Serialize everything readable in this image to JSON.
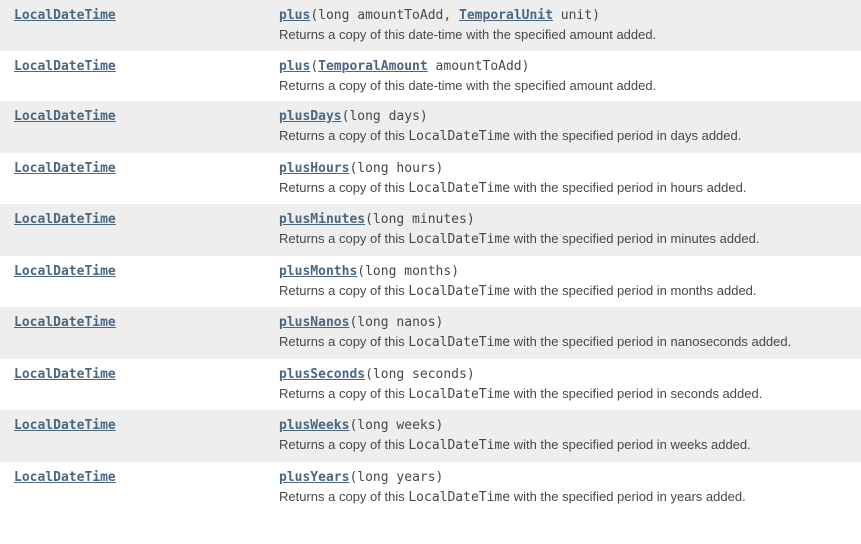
{
  "methods": [
    {
      "returnType": "LocalDateTime",
      "name": "plus",
      "sigLead": "(long amountToAdd, ",
      "paramType": "TemporalUnit",
      "sigTail": " unit)",
      "desc": "Returns a copy of this date-time with the specified amount added."
    },
    {
      "returnType": "LocalDateTime",
      "name": "plus",
      "sigLead": "(",
      "paramType": "TemporalAmount",
      "sigTail": " amountToAdd)",
      "desc": "Returns a copy of this date-time with the specified amount added."
    },
    {
      "returnType": "LocalDateTime",
      "name": "plusDays",
      "sigLead": "(long days)",
      "paramType": "",
      "sigTail": "",
      "desc": "Returns a copy of this <code>LocalDateTime</code> with the specified period in days added."
    },
    {
      "returnType": "LocalDateTime",
      "name": "plusHours",
      "sigLead": "(long hours)",
      "paramType": "",
      "sigTail": "",
      "desc": "Returns a copy of this <code>LocalDateTime</code> with the specified period in hours added."
    },
    {
      "returnType": "LocalDateTime",
      "name": "plusMinutes",
      "sigLead": "(long minutes)",
      "paramType": "",
      "sigTail": "",
      "desc": "Returns a copy of this <code>LocalDateTime</code> with the specified period in minutes added."
    },
    {
      "returnType": "LocalDateTime",
      "name": "plusMonths",
      "sigLead": "(long months)",
      "paramType": "",
      "sigTail": "",
      "desc": "Returns a copy of this <code>LocalDateTime</code> with the specified period in months added."
    },
    {
      "returnType": "LocalDateTime",
      "name": "plusNanos",
      "sigLead": "(long nanos)",
      "paramType": "",
      "sigTail": "",
      "desc": "Returns a copy of this <code>LocalDateTime</code> with the specified period in nanoseconds added."
    },
    {
      "returnType": "LocalDateTime",
      "name": "plusSeconds",
      "sigLead": "(long seconds)",
      "paramType": "",
      "sigTail": "",
      "desc": "Returns a copy of this <code>LocalDateTime</code> with the specified period in seconds added."
    },
    {
      "returnType": "LocalDateTime",
      "name": "plusWeeks",
      "sigLead": "(long weeks)",
      "paramType": "",
      "sigTail": "",
      "desc": "Returns a copy of this <code>LocalDateTime</code> with the specified period in weeks added."
    },
    {
      "returnType": "LocalDateTime",
      "name": "plusYears",
      "sigLead": "(long years)",
      "paramType": "",
      "sigTail": "",
      "desc": "Returns a copy of this <code>LocalDateTime</code> with the specified period in years added."
    }
  ]
}
